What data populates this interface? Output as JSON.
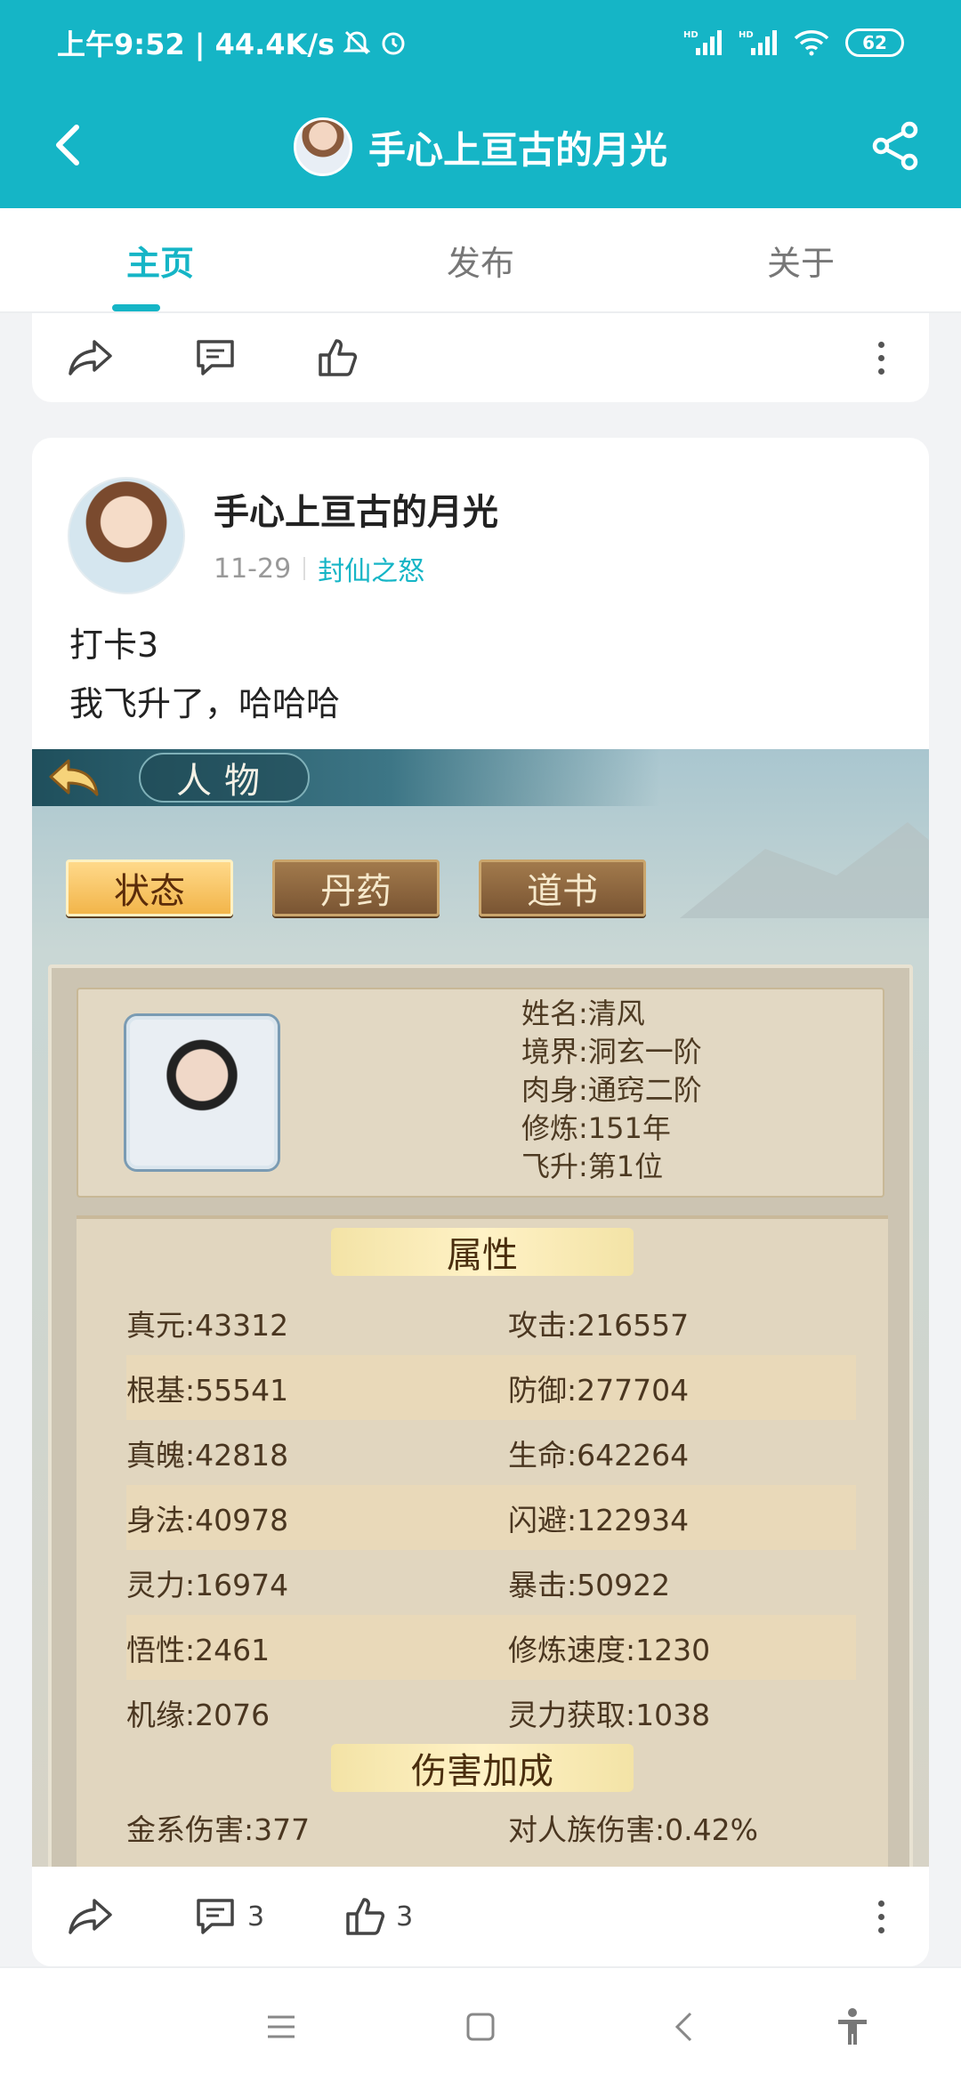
{
  "status_bar": {
    "time_speed": "上午9:52 | 44.4K/s",
    "signal_1": "HD",
    "signal_2": "HD",
    "battery": "62"
  },
  "app_bar": {
    "title": "手心上亘古的月光"
  },
  "tabs": [
    {
      "label": "主页",
      "active": true
    },
    {
      "label": "发布",
      "active": false
    },
    {
      "label": "关于",
      "active": false
    }
  ],
  "post": {
    "author": "手心上亘古的月光",
    "date": "11-29",
    "topic": "封仙之怒",
    "text_line1": "打卡3",
    "text_line2": "我飞升了，哈哈哈",
    "comment_count": "3",
    "like_count": "3"
  },
  "game": {
    "title": "人物",
    "tabs": [
      "状态",
      "丹药",
      "道书"
    ],
    "char_info": {
      "name": "姓名:清风",
      "realm": "境界:洞玄一阶",
      "body": "肉身:通窍二阶",
      "cultivation": "修炼:151年",
      "ascension": "飞升:第1位"
    },
    "section_attr": "属性",
    "section_dmg": "伤害加成",
    "stats": [
      {
        "left": "真元:43312",
        "right": "攻击:216557"
      },
      {
        "left": "根基:55541",
        "right": "防御:277704"
      },
      {
        "left": "真魄:42818",
        "right": "生命:642264"
      },
      {
        "left": "身法:40978",
        "right": "闪避:122934"
      },
      {
        "left": "灵力:16974",
        "right": "暴击:50922"
      },
      {
        "left": "悟性:2461",
        "right": "修炼速度:1230"
      },
      {
        "left": "机缘:2076",
        "right": "灵力获取:1038"
      }
    ],
    "dmg": {
      "left": "金系伤害:377",
      "right": "对人族伤害:0.42%"
    }
  },
  "colors": {
    "accent": "#15b5c6"
  }
}
